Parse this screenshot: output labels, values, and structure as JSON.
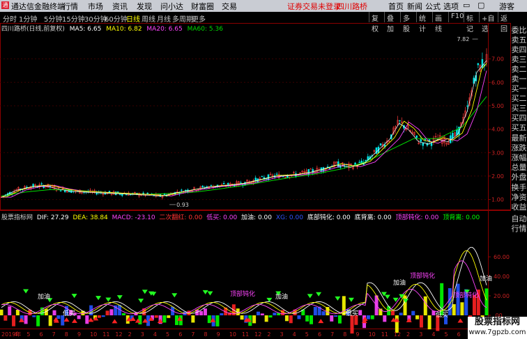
{
  "titlebar": {
    "app_name": "通达信金融终端",
    "menu": [
      "行情",
      "市场",
      "资讯",
      "发现",
      "问小达",
      "财富圈",
      "交易"
    ],
    "broker_status": "证券交易未登录",
    "stock_name": "四川路桥",
    "home": "首页",
    "news": "新闻",
    "formula": "公式",
    "options": "选项",
    "guest": "游客"
  },
  "toolbar": {
    "periods": [
      "分时",
      "1分钟",
      "5分钟",
      "15分钟",
      "30分钟",
      "60分钟",
      "日线",
      "周线",
      "月线",
      "多周期",
      "更多"
    ],
    "active_period": "日线",
    "right_buttons": [
      "复权",
      "叠加",
      "多股",
      "统计",
      "画线",
      "F10",
      "标记",
      "+自选",
      "返回"
    ]
  },
  "kline_info": {
    "label": "四川路桥(日线,前复权)",
    "ma5": "MA5: 6.65",
    "ma10": "MA10: 6.82",
    "ma20": "MA20: 6.65",
    "ma60": "MA60: 5.36",
    "colors": {
      "ma5": "#ffffff",
      "ma10": "#ffff00",
      "ma20": "#ff44ff",
      "ma60": "#00dd00"
    }
  },
  "indicator_info": {
    "label": "股票指标网",
    "dif": "DIF: 27.29",
    "dea": "DEA: 38.84",
    "macd": "MACD: -23.10",
    "items": [
      {
        "text": "二次翻红: 0.00",
        "color": "#ff3333"
      },
      {
        "text": "低买: 0.00",
        "color": "#ff44ff"
      },
      {
        "text": "加油: 0.00",
        "color": "#ffffff"
      },
      {
        "text": "XG: 0.00",
        "color": "#3355ff"
      },
      {
        "text": "底部钝化: 0.00",
        "color": "#ffffff"
      },
      {
        "text": "底背离: 0.00",
        "color": "#ffffff"
      },
      {
        "text": "顶部钝化: 0.00",
        "color": "#ff44ff"
      },
      {
        "text": "顶背离: 0.00",
        "color": "#00ff00"
      }
    ]
  },
  "sidebar": {
    "items": [
      "委比",
      "卖五",
      "卖四",
      "卖三",
      "卖二",
      "卖一",
      "买一",
      "买二",
      "买三",
      "买四",
      "买五",
      "最新",
      "涨跌",
      "涨幅",
      "总量",
      "外盘",
      "换手",
      "净资",
      "收益"
    ],
    "bottom_items": [
      "自动",
      "行情"
    ]
  },
  "watermark": {
    "line1": "股票指标网",
    "line2": "www.7gpzb.com"
  },
  "chart_data": {
    "type": "line",
    "title": "四川路桥(日线,前复权)",
    "price_axis": {
      "ticks": [
        1.0,
        2.0,
        3.0,
        4.0,
        5.0,
        6.0,
        7.0
      ],
      "labels": [
        "1.00",
        "2.00",
        "3.00",
        "4.00",
        "5.00",
        "6.00",
        "7.00"
      ],
      "ylim": [
        0.75,
        8.0
      ]
    },
    "annotations": [
      {
        "text": "7.82",
        "value": 7.82
      },
      {
        "text": "0.93",
        "value": 0.93
      }
    ],
    "series": [
      {
        "name": "MA60",
        "color": "#00dd00",
        "x": [
          0,
          0.05,
          0.1,
          0.15,
          0.2,
          0.25,
          0.3,
          0.35,
          0.4,
          0.45,
          0.5,
          0.55,
          0.6,
          0.65,
          0.7,
          0.75,
          0.8,
          0.85,
          0.9,
          0.95,
          1.0
        ],
        "values": [
          1.15,
          1.32,
          1.42,
          1.4,
          1.32,
          1.25,
          1.22,
          1.26,
          1.32,
          1.45,
          1.6,
          1.78,
          1.95,
          2.1,
          2.3,
          2.6,
          3.1,
          3.6,
          3.6,
          4.1,
          5.4
        ]
      },
      {
        "name": "价格",
        "color": "#ffffff",
        "x": [
          0,
          0.03,
          0.06,
          0.09,
          0.12,
          0.15,
          0.2,
          0.25,
          0.3,
          0.33,
          0.36,
          0.4,
          0.43,
          0.46,
          0.5,
          0.53,
          0.56,
          0.6,
          0.63,
          0.66,
          0.69,
          0.72,
          0.75,
          0.77,
          0.8,
          0.82,
          0.84,
          0.86,
          0.88,
          0.9,
          0.92,
          0.94,
          0.96,
          0.98,
          1.0
        ],
        "values": [
          1.1,
          1.4,
          1.55,
          1.6,
          1.45,
          1.35,
          1.3,
          1.25,
          1.2,
          1.15,
          1.3,
          1.45,
          1.55,
          1.6,
          1.7,
          1.85,
          2.0,
          2.05,
          2.15,
          2.3,
          2.5,
          2.4,
          2.6,
          3.0,
          3.6,
          4.3,
          4.0,
          3.5,
          3.4,
          3.6,
          3.5,
          3.8,
          4.8,
          6.5,
          7.0
        ]
      }
    ],
    "indicator_axis": {
      "ticks": [
        0,
        20,
        40,
        60
      ],
      "labels": [
        ".00",
        "20.00",
        "40.00",
        "60.00"
      ]
    },
    "x_axis_labels": [
      "2019年",
      "4",
      "5",
      "6",
      "7",
      "8",
      "9",
      "10",
      "11",
      "12",
      "2",
      "3",
      "4",
      "5",
      "6",
      "7",
      "8",
      "9",
      "10",
      "11",
      "12",
      "2",
      "3",
      "4",
      "5",
      "6",
      "7",
      "8",
      "9",
      "10",
      "11",
      "12",
      "2",
      "3",
      "4",
      "5",
      "6",
      "7",
      "8"
    ]
  }
}
